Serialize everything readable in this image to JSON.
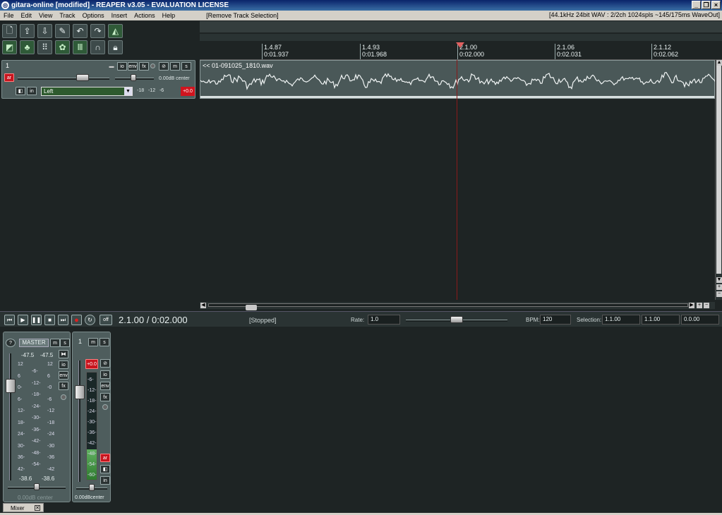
{
  "window": {
    "title": "gitara-online [modified] - REAPER v3.05 - EVALUATION LICENSE",
    "minimize": "_",
    "restore": "❐",
    "close": "×"
  },
  "menu": {
    "items": [
      "File",
      "Edit",
      "View",
      "Track",
      "Options",
      "Insert",
      "Actions",
      "Help"
    ],
    "last_action": "[Remove Track Selection]",
    "audio_info": "[44.1kHz 24bit WAV : 2/2ch 1024spls ~145/175ms WaveOut]"
  },
  "toolbar": {
    "icons": [
      "new-project-icon",
      "open-project-icon",
      "save-project-icon",
      "preferences-icon",
      "undo-icon",
      "redo-icon",
      "metronome-icon",
      "grid-icon",
      "snap-icon",
      "media-explorer-icon",
      "ripple-icon",
      "loop-icon",
      "magnet-icon",
      "lock-icon"
    ]
  },
  "track": {
    "number": "1",
    "volume_label": "0.00dB center",
    "input": "Left",
    "meter_scale": [
      "-18",
      "-12",
      "-6"
    ],
    "peak": "+0.0",
    "btn_io": "io",
    "btn_env": "env",
    "btn_fx": "fx",
    "btn_m": "m",
    "btn_s": "s",
    "btn_arm": "ar",
    "btn_in": "in"
  },
  "ruler": {
    "ticks": [
      {
        "bar": "1.4.87",
        "time": "0:01.937"
      },
      {
        "bar": "1.4.93",
        "time": "0:01.968"
      },
      {
        "bar": "2.1.00",
        "time": "0:02.000"
      },
      {
        "bar": "2.1.06",
        "time": "0:02.031"
      },
      {
        "bar": "2.1.12",
        "time": "0:02.062"
      }
    ]
  },
  "item": {
    "name": "<< 01-091025_1810.wav"
  },
  "transport": {
    "time": "2.1.00 / 0:02.000",
    "status": "[Stopped]",
    "rate_label": "Rate:",
    "rate": "1.0",
    "bpm_label": "BPM:",
    "bpm": "120",
    "selection_label": "Selection:",
    "sel_start": "1.1.00",
    "sel_end": "1.1.00",
    "sel_len": "0.0.00",
    "repeat_label": "off"
  },
  "mixer": {
    "master": {
      "label": "MASTER",
      "peak_l": "-47.5",
      "peak_r": "-47.5",
      "rms_l": "-38.6",
      "rms_r": "-38.6",
      "volume": "0.00dB center",
      "scale_left": [
        "12",
        "6",
        "0-",
        "6-",
        "12-",
        "18-",
        "24-",
        "30-",
        "36-",
        "42-"
      ],
      "scale_mid": [
        "-6-",
        "-12-",
        "-18-",
        "-24-",
        "-30-",
        "-36-",
        "-42-",
        "-48-",
        "-54-"
      ],
      "scale_right": [
        "12",
        "6",
        "-0",
        "-6",
        "-12",
        "-18",
        "-24",
        "-30",
        "-36",
        "-42"
      ]
    },
    "track1": {
      "number": "1",
      "peak": "+0.0",
      "volume": "0.00dBcenter",
      "scale": [
        "-6-",
        "-12-",
        "-18-",
        "-24-",
        "-30-",
        "-36-",
        "-42-",
        "-48-",
        "-54-",
        "-60-"
      ],
      "level_fraction": 0.28
    },
    "tab_label": "Mixer",
    "tab_close": "✕"
  }
}
